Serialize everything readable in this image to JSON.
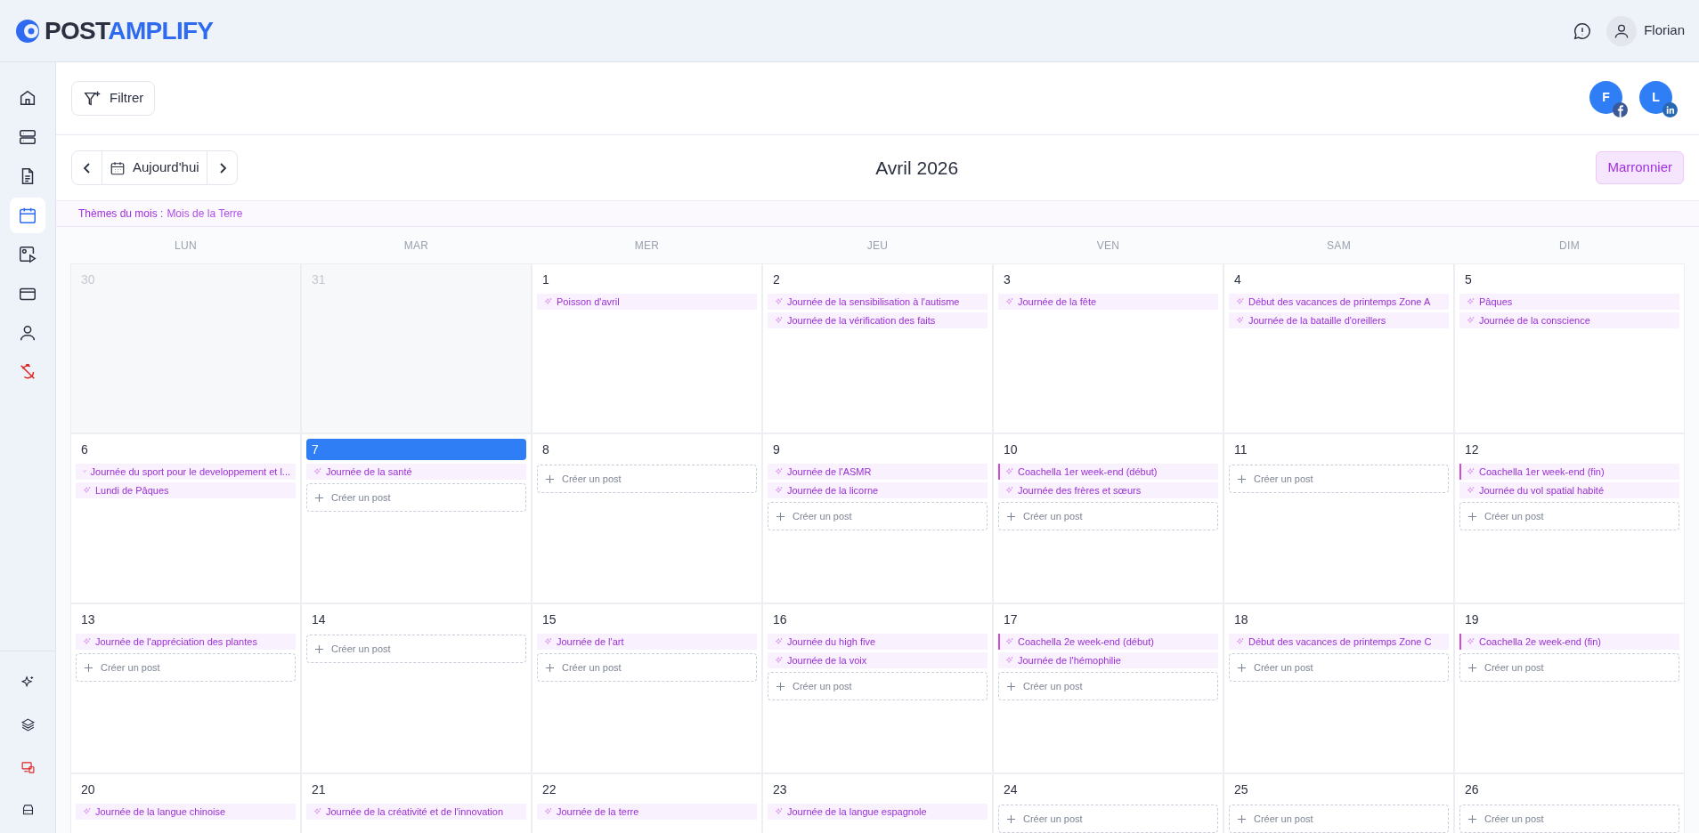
{
  "header": {
    "logo_dark": "POST",
    "logo_accent": "AMPLIFY",
    "user_name": "Florian"
  },
  "sidebar": {
    "items": [
      {
        "kind": "home",
        "selected": false
      },
      {
        "kind": "servers",
        "selected": false
      },
      {
        "kind": "document",
        "selected": false
      },
      {
        "kind": "calendar",
        "selected": true
      },
      {
        "kind": "media",
        "selected": false
      },
      {
        "kind": "card",
        "selected": false
      },
      {
        "kind": "user",
        "selected": false
      },
      {
        "kind": "timer-off",
        "selected": false
      }
    ],
    "bottom_items": [
      {
        "kind": "sparkles"
      },
      {
        "kind": "layers"
      },
      {
        "kind": "devices"
      },
      {
        "kind": "drive"
      }
    ]
  },
  "toolbar": {
    "filter_label": "Filtrer",
    "accounts": [
      {
        "initial": "F",
        "kind": "facebook"
      },
      {
        "initial": "L",
        "kind": "linkedin"
      }
    ]
  },
  "navigation": {
    "today_label": "Aujourd'hui",
    "month_title": "Avril 2026",
    "marronnier_label": "Marronnier"
  },
  "themes": {
    "label": "Thèmes du mois :",
    "value": "Mois de la Terre"
  },
  "calendar": {
    "weekdays": [
      "LUN",
      "MAR",
      "MER",
      "JEU",
      "VEN",
      "SAM",
      "DIM"
    ],
    "days": [
      {
        "number": "30",
        "outside": true,
        "selected": false
      },
      {
        "number": "31",
        "outside": true,
        "selected": false
      },
      {
        "number": "1",
        "outside": false,
        "selected": false,
        "events": [
          {
            "title": "Poisson d'avril",
            "span_mark": false
          }
        ]
      },
      {
        "number": "2",
        "outside": false,
        "selected": false,
        "events": [
          {
            "title": "Journée de la sensibilisation à l'autisme",
            "span_mark": false
          },
          {
            "title": "Journée de la vérification des faits",
            "span_mark": false
          }
        ]
      },
      {
        "number": "3",
        "outside": false,
        "selected": false,
        "events": [
          {
            "title": "Journée de la fête",
            "span_mark": false
          }
        ]
      },
      {
        "number": "4",
        "outside": false,
        "selected": false,
        "events": [
          {
            "title": "Début des vacances de printemps Zone A",
            "span_mark": false
          },
          {
            "title": "Journée de la bataille d'oreillers",
            "span_mark": false
          }
        ]
      },
      {
        "number": "5",
        "outside": false,
        "selected": false,
        "events": [
          {
            "title": "Pâques",
            "span_mark": false
          },
          {
            "title": "Journée de la conscience",
            "span_mark": false
          }
        ]
      },
      {
        "number": "6",
        "outside": false,
        "selected": false,
        "events": [
          {
            "title": "Journée du sport pour le developpement et l...",
            "span_mark": false
          },
          {
            "title": "Lundi de Pâques",
            "span_mark": false
          }
        ]
      },
      {
        "number": "7",
        "outside": false,
        "selected": true,
        "events": [
          {
            "title": "Journée de la santé",
            "span_mark": false
          }
        ],
        "create": "Créer un post"
      },
      {
        "number": "8",
        "outside": false,
        "selected": false,
        "create": "Créer un post"
      },
      {
        "number": "9",
        "outside": false,
        "selected": false,
        "events": [
          {
            "title": "Journée de l'ASMR",
            "span_mark": false
          },
          {
            "title": "Journée de la licorne",
            "span_mark": false
          }
        ],
        "create": "Créer un post"
      },
      {
        "number": "10",
        "outside": false,
        "selected": false,
        "events": [
          {
            "title": "Coachella 1er week-end (début)",
            "span_mark": true
          },
          {
            "title": "Journée des frères et sœurs",
            "span_mark": false
          }
        ],
        "create": "Créer un post"
      },
      {
        "number": "11",
        "outside": false,
        "selected": false,
        "create": "Créer un post"
      },
      {
        "number": "12",
        "outside": false,
        "selected": false,
        "events": [
          {
            "title": "Coachella 1er week-end (fin)",
            "span_mark": true
          },
          {
            "title": "Journée du vol spatial habité",
            "span_mark": false
          }
        ],
        "create": "Créer un post"
      },
      {
        "number": "13",
        "outside": false,
        "selected": false,
        "events": [
          {
            "title": "Journée de l'appréciation des plantes",
            "span_mark": false
          }
        ],
        "create": "Créer un post"
      },
      {
        "number": "14",
        "outside": false,
        "selected": false,
        "create": "Créer un post"
      },
      {
        "number": "15",
        "outside": false,
        "selected": false,
        "events": [
          {
            "title": "Journée de l'art",
            "span_mark": false
          }
        ],
        "create": "Créer un post"
      },
      {
        "number": "16",
        "outside": false,
        "selected": false,
        "events": [
          {
            "title": "Journée du high five",
            "span_mark": false
          },
          {
            "title": "Journée de la voix",
            "span_mark": false
          }
        ],
        "create": "Créer un post"
      },
      {
        "number": "17",
        "outside": false,
        "selected": false,
        "events": [
          {
            "title": "Coachella 2e week-end (début)",
            "span_mark": true
          },
          {
            "title": "Journée de l'hémophilie",
            "span_mark": false
          }
        ],
        "create": "Créer un post"
      },
      {
        "number": "18",
        "outside": false,
        "selected": false,
        "events": [
          {
            "title": "Début des vacances de printemps Zone C",
            "span_mark": false
          }
        ],
        "create": "Créer un post"
      },
      {
        "number": "19",
        "outside": false,
        "selected": false,
        "events": [
          {
            "title": "Coachella 2e week-end (fin)",
            "span_mark": true
          }
        ],
        "create": "Créer un post"
      },
      {
        "number": "20",
        "outside": false,
        "selected": false,
        "events": [
          {
            "title": "Journée de la langue chinoise",
            "span_mark": false
          }
        ]
      },
      {
        "number": "21",
        "outside": false,
        "selected": false,
        "events": [
          {
            "title": "Journée de la créativité et de l'innovation",
            "span_mark": false
          }
        ]
      },
      {
        "number": "22",
        "outside": false,
        "selected": false,
        "events": [
          {
            "title": "Journée de la terre",
            "span_mark": false
          }
        ]
      },
      {
        "number": "23",
        "outside": false,
        "selected": false,
        "events": [
          {
            "title": "Journée de la langue espagnole",
            "span_mark": false
          }
        ]
      },
      {
        "number": "24",
        "outside": false,
        "selected": false,
        "create": "Créer un post"
      },
      {
        "number": "25",
        "outside": false,
        "selected": false,
        "create": "Créer un post"
      },
      {
        "number": "26",
        "outside": false,
        "selected": false,
        "create": "Créer un post"
      }
    ]
  }
}
